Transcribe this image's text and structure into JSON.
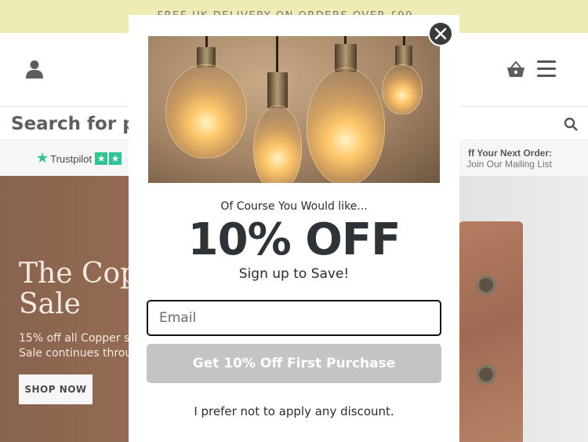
{
  "announcement": {
    "text": "FREE UK DELIVERY ON ORDERS OVER £99 ..."
  },
  "header": {
    "account_icon": "user-icon",
    "cart_icon": "basket-icon",
    "menu_icon": "hamburger-menu-icon"
  },
  "search": {
    "placeholder": "Search for pro",
    "icon": "search-icon"
  },
  "trust": {
    "brand": "Trustpilot",
    "mailing_title": "ff Your Next Order:",
    "mailing_sub": "Join Our Mailing List"
  },
  "hero": {
    "title": "The Cop\nSale",
    "subtitle": "15% off all Copper so\nSale continues throug",
    "cta": "SHOP NOW"
  },
  "modal": {
    "lead": "Of Course You Would like...",
    "headline": "10% OFF",
    "subline": "Sign up to Save!",
    "email_placeholder": "Email",
    "cta": "Get 10% Off First Purchase",
    "decline": "I prefer not to apply any discount.",
    "close_icon": "close-icon"
  },
  "colors": {
    "announcement_bg": "#e9e8a5",
    "trustpilot_green": "#00b67a",
    "cta_disabled": "#c4c4c4",
    "headline": "#2d3337"
  }
}
